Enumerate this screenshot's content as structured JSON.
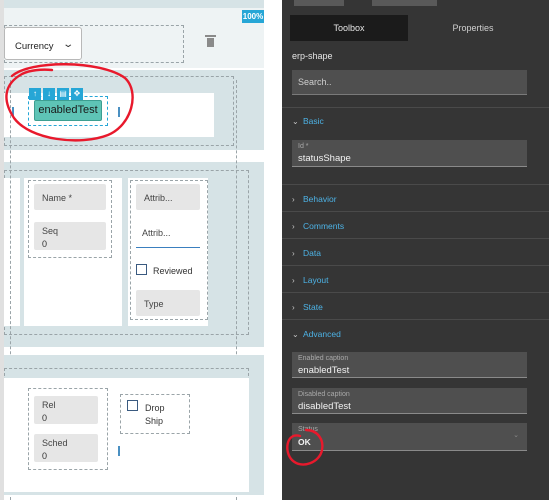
{
  "canvas": {
    "zoom_badge": "100%",
    "currency_select": {
      "label": "Currency"
    },
    "toolbar_icons": [
      "arrow-up-icon",
      "arrow-down-icon",
      "copy-icon",
      "move-icon"
    ],
    "enabled_button_label": "enabledTest",
    "fields": {
      "name": "Name *",
      "seq": "Seq",
      "seq_value": "0",
      "attrib_1": "Attrib...",
      "attrib_2": "Attrib...",
      "reviewed": "Reviewed",
      "type": "Type",
      "rel": "Rel",
      "rel_value": "0",
      "sched": "Sched",
      "sched_value": "0",
      "drop": "Drop",
      "ship": "Ship"
    }
  },
  "sidebar": {
    "tabs": {
      "toolbox": "Toolbox",
      "properties": "Properties"
    },
    "component_name": "erp-shape",
    "search_placeholder": "Search..",
    "sections": {
      "basic": "Basic",
      "behavior": "Behavior",
      "comments": "Comments",
      "data": "Data",
      "layout": "Layout",
      "state": "State",
      "advanced": "Advanced"
    },
    "basic_fields": {
      "id_caption": "Id *",
      "id_value": "statusShape"
    },
    "advanced_fields": {
      "enabled_caption": "Enabled caption",
      "enabled_value": "enabledTest",
      "disabled_caption": "Disabled caption",
      "disabled_value": "disabledTest",
      "status_caption": "Status",
      "status_value": "OK"
    }
  },
  "colors": {
    "accent": "#26a6d6",
    "section_title": "#4db3e6",
    "shape_button": "#5ec4b6",
    "annotation": "#e8192c"
  }
}
